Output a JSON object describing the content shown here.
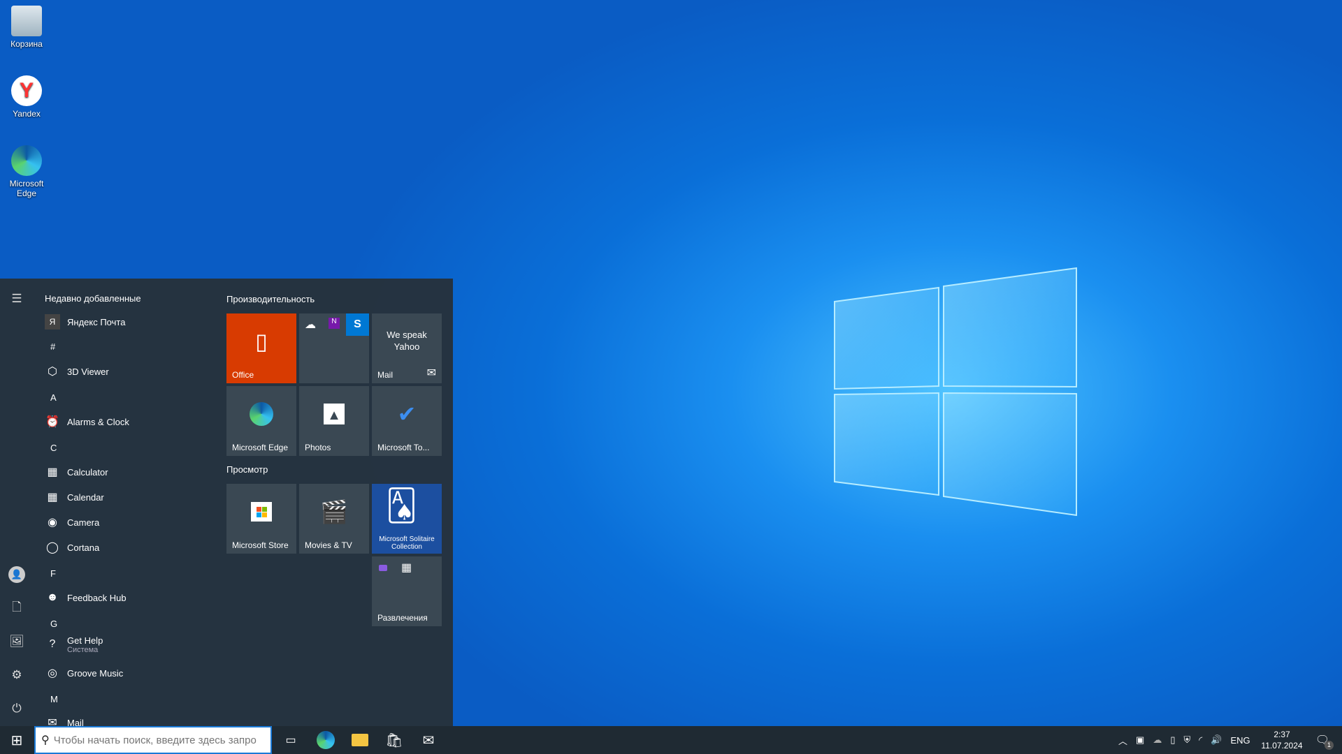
{
  "desktop": {
    "icons": [
      {
        "label": "Корзина",
        "icon": "recycle-bin-icon"
      },
      {
        "label": "Yandex",
        "icon": "yandex-browser-icon"
      },
      {
        "label": "Microsoft Edge",
        "icon": "edge-icon"
      }
    ]
  },
  "start": {
    "recent_header": "Недавно добавленные",
    "recent": [
      {
        "label": "Яндекс Почта",
        "glyph": "Я"
      }
    ],
    "sections": [
      {
        "letter": "#",
        "apps": [
          {
            "label": "3D Viewer",
            "icon": "cube-icon",
            "glyph": "⬡"
          }
        ]
      },
      {
        "letter": "A",
        "apps": [
          {
            "label": "Alarms & Clock",
            "icon": "alarm-clock-icon",
            "glyph": "⏰"
          }
        ]
      },
      {
        "letter": "C",
        "apps": [
          {
            "label": "Calculator",
            "icon": "calculator-icon",
            "glyph": "▦"
          },
          {
            "label": "Calendar",
            "icon": "calendar-icon",
            "glyph": "▦"
          },
          {
            "label": "Camera",
            "icon": "camera-icon",
            "glyph": "◉"
          },
          {
            "label": "Cortana",
            "icon": "cortana-icon",
            "glyph": "◯"
          }
        ]
      },
      {
        "letter": "F",
        "apps": [
          {
            "label": "Feedback Hub",
            "icon": "feedback-icon",
            "glyph": "☻"
          }
        ]
      },
      {
        "letter": "G",
        "apps": [
          {
            "label": "Get Help",
            "sub": "Система",
            "icon": "help-icon",
            "glyph": "?"
          },
          {
            "label": "Groove Music",
            "icon": "groove-icon",
            "glyph": "◎"
          }
        ]
      },
      {
        "letter": "M",
        "apps": [
          {
            "label": "Mail",
            "icon": "mail-icon",
            "glyph": "✉"
          }
        ]
      }
    ],
    "groups": [
      {
        "title": "Производительность",
        "tiles": [
          {
            "label": "Office",
            "icon": "office-icon",
            "color": "#d83b01"
          },
          {
            "label": "",
            "icon": "onedrive-onenote-skype-folder-icon"
          },
          {
            "label": "Mail",
            "text": "We speak Yahoo",
            "icon": "mail-icon"
          },
          {
            "label": "Microsoft Edge",
            "icon": "edge-icon"
          },
          {
            "label": "Photos",
            "icon": "photos-icon"
          },
          {
            "label": "Microsoft To...",
            "icon": "todo-icon"
          }
        ]
      },
      {
        "title": "Просмотр",
        "tiles": [
          {
            "label": "Microsoft Store",
            "icon": "store-icon"
          },
          {
            "label": "Movies & TV",
            "icon": "movies-icon"
          },
          {
            "label": "Microsoft Solitaire Collection",
            "icon": "solitaire-icon",
            "color": "#1c4fa0"
          },
          {
            "label": "Развлечения",
            "icon": "folder-icon"
          }
        ]
      }
    ]
  },
  "taskbar": {
    "search_placeholder": "Чтобы начать поиск, введите здесь запрос",
    "lang": "ENG",
    "time": "2:37",
    "date": "11.07.2024",
    "notifications": "1"
  }
}
